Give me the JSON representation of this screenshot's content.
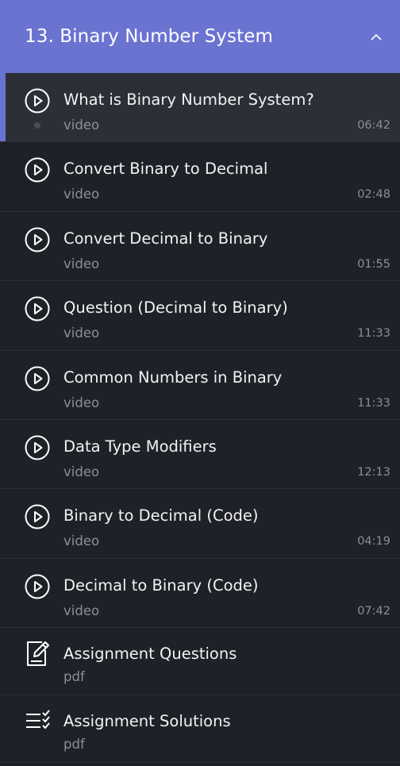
{
  "section": {
    "title": "13. Binary Number System"
  },
  "items": [
    {
      "title": "What is Binary Number System?",
      "type": "video",
      "duration": "06:42",
      "active": true
    },
    {
      "title": "Convert Binary to Decimal",
      "type": "video",
      "duration": "02:48"
    },
    {
      "title": "Convert Decimal to Binary",
      "type": "video",
      "duration": "01:55"
    },
    {
      "title": "Question (Decimal to Binary)",
      "type": "video",
      "duration": "11:33"
    },
    {
      "title": "Common Numbers in Binary",
      "type": "video",
      "duration": "11:33"
    },
    {
      "title": "Data Type Modifiers",
      "type": "video",
      "duration": "12:13"
    },
    {
      "title": "Binary to Decimal (Code)",
      "type": "video",
      "duration": "04:19"
    },
    {
      "title": "Decimal to Binary (Code)",
      "type": "video",
      "duration": "07:42"
    },
    {
      "title": "Assignment Questions",
      "type": "pdf",
      "icon": "assignment-edit-icon"
    },
    {
      "title": "Assignment Solutions",
      "type": "pdf",
      "icon": "checklist-icon"
    }
  ],
  "colors": {
    "accent": "#6b73d1",
    "background": "#1f2128",
    "active_row": "#2c2f38"
  }
}
